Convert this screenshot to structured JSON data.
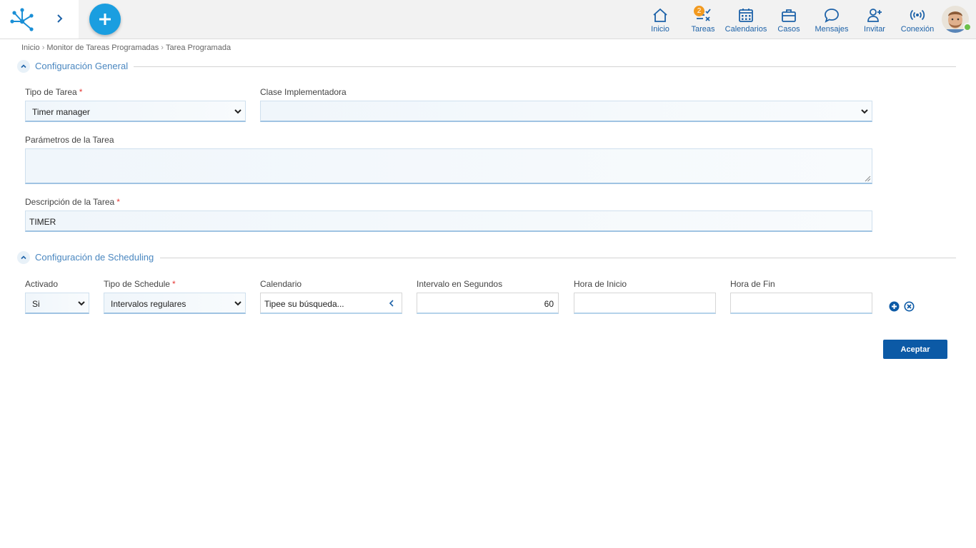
{
  "nav": {
    "items": [
      {
        "label": "Inicio",
        "icon": "home-icon"
      },
      {
        "label": "Tareas",
        "icon": "tasks-icon",
        "badge": "2"
      },
      {
        "label": "Calendarios",
        "icon": "calendar-icon"
      },
      {
        "label": "Casos",
        "icon": "briefcase-icon"
      },
      {
        "label": "Mensajes",
        "icon": "chat-icon"
      },
      {
        "label": "Invitar",
        "icon": "add-user-icon"
      },
      {
        "label": "Conexión",
        "icon": "connection-icon"
      }
    ],
    "accent": "#1a9ee0",
    "label_color": "#1d62a8"
  },
  "breadcrumb": [
    "Inicio",
    "Monitor de Tareas Programadas",
    "Tarea Programada"
  ],
  "general": {
    "title": "Configuración General",
    "tipo_tarea": {
      "label": "Tipo de Tarea",
      "required": "*",
      "value": "Timer manager"
    },
    "clase": {
      "label": "Clase Implementadora",
      "value": ""
    },
    "parametros": {
      "label": "Parámetros de la Tarea",
      "value": ""
    },
    "descripcion": {
      "label": "Descripción de la Tarea",
      "required": "*",
      "value": "TIMER"
    }
  },
  "scheduling": {
    "title": "Configuración de Scheduling",
    "activado": {
      "label": "Activado",
      "value": "Si"
    },
    "tipo_schedule": {
      "label": "Tipo de Schedule",
      "required": "*",
      "value": "Intervalos regulares"
    },
    "calendario": {
      "label": "Calendario",
      "value": "Tipee su búsqueda..."
    },
    "intervalo": {
      "label": "Intervalo en Segundos",
      "value": "60"
    },
    "hora_inicio": {
      "label": "Hora de Inicio",
      "value": ""
    },
    "hora_fin": {
      "label": "Hora de Fin",
      "value": ""
    }
  },
  "actions": {
    "accept": "Aceptar"
  }
}
